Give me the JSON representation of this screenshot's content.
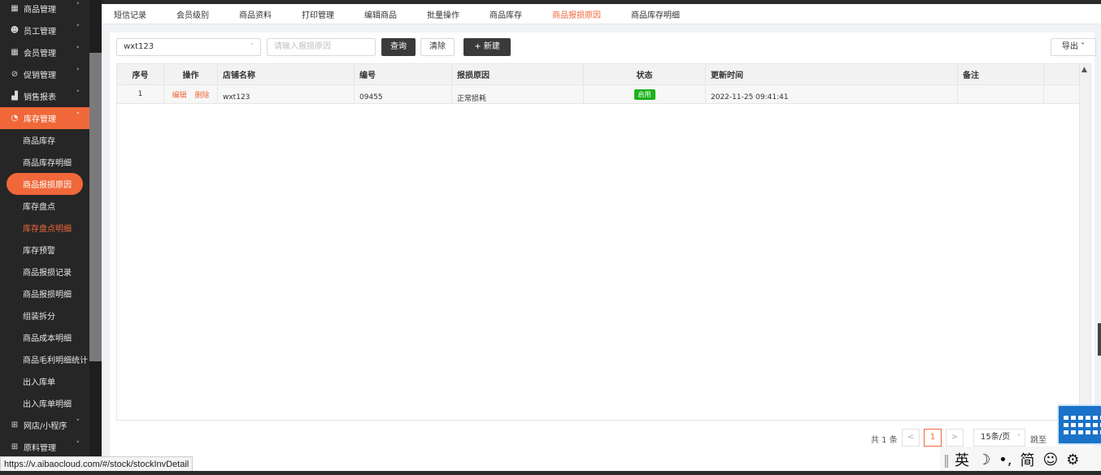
{
  "sidebar": {
    "groups_top": [
      {
        "label": "商品管理",
        "icon": "grid-icon"
      },
      {
        "label": "员工管理",
        "icon": "user-icon"
      },
      {
        "label": "会员管理",
        "icon": "member-card-icon"
      },
      {
        "label": "促销管理",
        "icon": "check-circle-icon"
      },
      {
        "label": "销售报表",
        "icon": "chart-icon"
      }
    ],
    "active_group": {
      "label": "库存管理",
      "icon": "pie-icon"
    },
    "sub_items": [
      "商品库存",
      "商品库存明细",
      "商品报损原因",
      "库存盘点",
      "库存盘点明细",
      "库存预警",
      "商品报损记录",
      "商品报损明细",
      "组装拆分",
      "商品成本明细",
      "商品毛利明细统计",
      "出入库单",
      "出入库单明细"
    ],
    "selected_sub": "商品报损原因",
    "highlight_sub": "库存盘点明细",
    "groups_bottom": [
      {
        "label": "网店/小程序",
        "icon": "store-icon"
      },
      {
        "label": "原料管理",
        "icon": "store-icon"
      }
    ]
  },
  "tabs": [
    {
      "label": "短信记录",
      "active": false
    },
    {
      "label": "会员级别",
      "active": false
    },
    {
      "label": "商品资料",
      "active": false
    },
    {
      "label": "打印管理",
      "active": false
    },
    {
      "label": "编辑商品",
      "active": false
    },
    {
      "label": "批量操作",
      "active": false
    },
    {
      "label": "商品库存",
      "active": false
    },
    {
      "label": "商品报损原因",
      "active": true
    },
    {
      "label": "商品库存明细",
      "active": false
    }
  ],
  "toolbar": {
    "store_select_value": "wxt123",
    "reason_placeholder": "请输入报损原因",
    "query_label": "查询",
    "clear_label": "清除",
    "new_label": "+ 新建",
    "export_label": "导出"
  },
  "table": {
    "headers": {
      "seq": "序号",
      "op": "操作",
      "store": "店铺名称",
      "code": "编号",
      "reason": "报损原因",
      "status": "状态",
      "time": "更新时间",
      "remark": "备注"
    },
    "rows": [
      {
        "seq": "1",
        "edit": "编辑",
        "delete": "删除",
        "store": "wxt123",
        "code": "09455",
        "reason": "正常损耗",
        "status": "启用",
        "time": "2022-11-25 09:41:41",
        "remark": ""
      }
    ]
  },
  "pager": {
    "total": "共 1 条",
    "prev": "<",
    "current": "1",
    "next": ">",
    "page_size": "15条/页",
    "jump": "跳至"
  },
  "status_url": "https://v.aibaocloud.com/#/stock/stockInvDetail",
  "ime": {
    "lang": "英",
    "moon": "☽",
    "punct": "•,",
    "simp": "简",
    "emoji": "☺",
    "gear": "⚙"
  },
  "colors": {
    "accent": "#f0683a",
    "sidebar_bg": "#262626",
    "status_green": "#1db21d",
    "dark_button": "#3a3a3a"
  }
}
